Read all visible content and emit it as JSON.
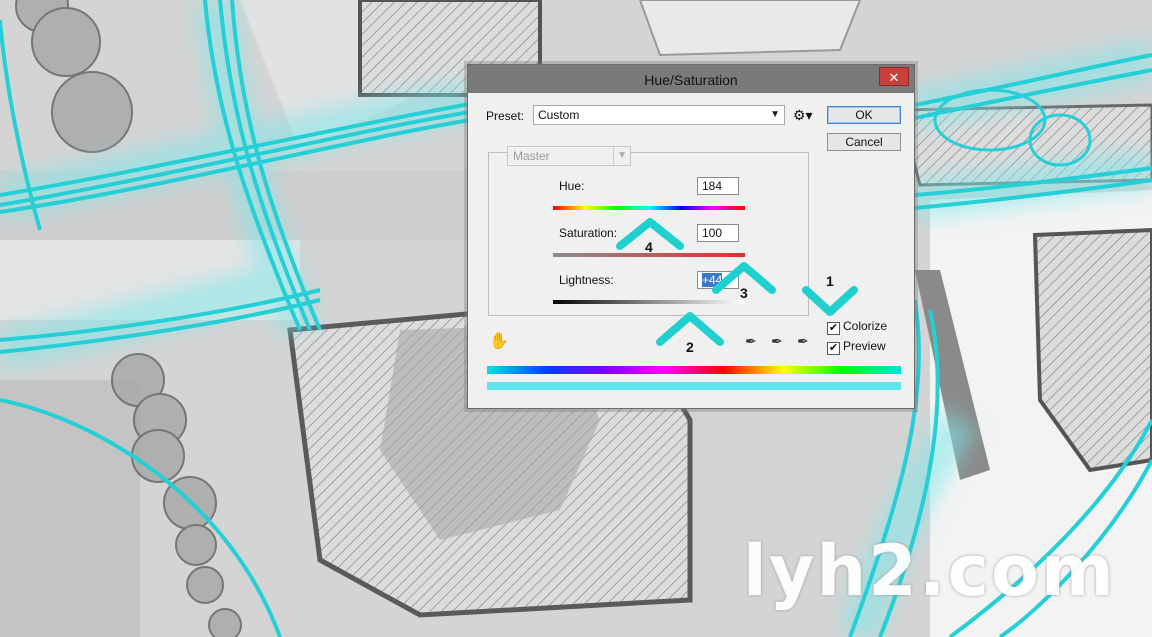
{
  "dialog": {
    "title": "Hue/Saturation",
    "close_glyph": "✕",
    "preset_label": "Preset:",
    "preset_value": "Custom",
    "channel_value": "Master",
    "ok_label": "OK",
    "cancel_label": "Cancel",
    "hue": {
      "label": "Hue:",
      "value": "184",
      "level": 184,
      "min": -180,
      "max": 180
    },
    "saturation": {
      "label": "Saturation:",
      "value": "100",
      "level": 100,
      "min": 0,
      "max": 100
    },
    "lightness": {
      "label": "Lightness:",
      "value": "+44",
      "level": 44,
      "min": -100,
      "max": 100
    },
    "colorize": {
      "label": "Colorize",
      "checked": true
    },
    "preview": {
      "label": "Preview",
      "checked": true
    },
    "check_glyph": "✔"
  },
  "annotations": [
    "1",
    "2",
    "3",
    "4"
  ],
  "watermark": "lyh2.com",
  "colors": {
    "accent_cyan": "#2fd6d6",
    "titlebar": "#7a7a7a",
    "close": "#c7403a",
    "highlight": "#3b78c8"
  }
}
